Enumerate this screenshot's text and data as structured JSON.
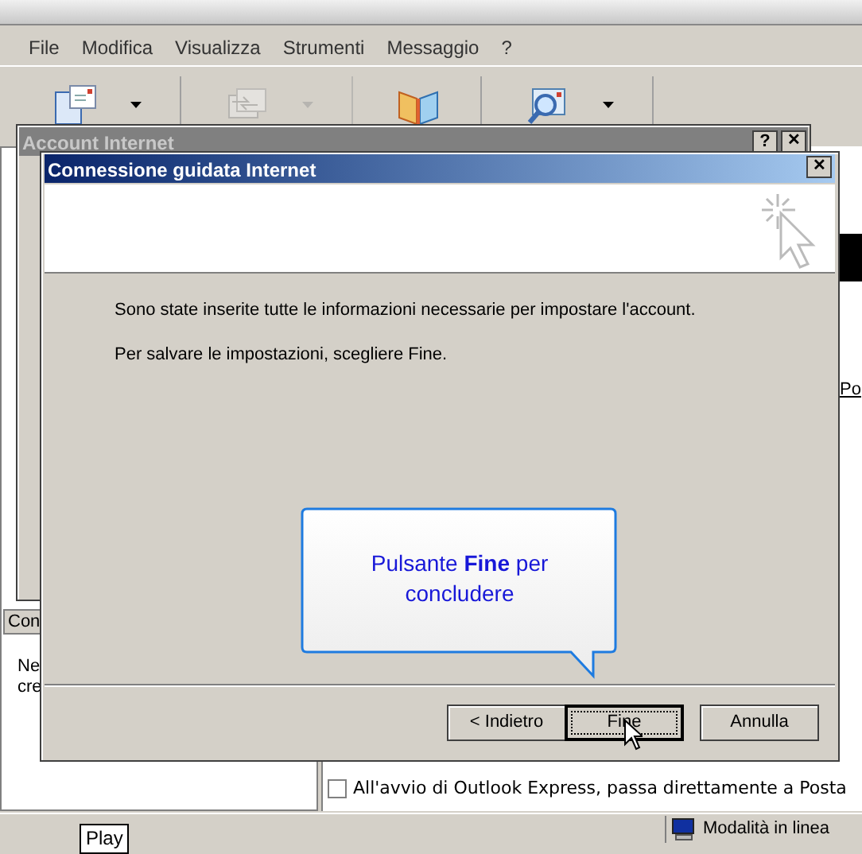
{
  "menu": [
    {
      "label": "File"
    },
    {
      "label": "Modifica"
    },
    {
      "label": "Visualizza"
    },
    {
      "label": "Strumenti"
    },
    {
      "label": "Messaggio"
    },
    {
      "label": "?"
    }
  ],
  "toolbar": [
    {
      "kind": "compose",
      "disabled": false,
      "dropdown": true
    },
    {
      "kind": "send_receive",
      "disabled": true,
      "dropdown": true
    },
    {
      "kind": "addresses",
      "disabled": false,
      "dropdown": false
    },
    {
      "kind": "find",
      "disabled": false,
      "dropdown": true
    }
  ],
  "left_pane": {
    "tab": "Con",
    "lines": [
      "Ne",
      "cre"
    ]
  },
  "right_pane": {
    "link": "Po",
    "startup_checkbox": {
      "label": "All'avvio di Outlook Express, passa direttamente a Posta",
      "checked": false
    }
  },
  "status_bar": {
    "mode": "Modalità in linea"
  },
  "tooltip": "Play",
  "account_dialog": {
    "title": "Account Internet",
    "help": "?",
    "close": "✕",
    "active": false
  },
  "wizard": {
    "title": "Connessione guidata Internet",
    "close": "✕",
    "active": true,
    "paragraphs": [
      "Sono state inserite tutte le informazioni necessarie per impostare l'account.",
      "Per salvare le impostazioni, scegliere Fine."
    ],
    "callout": "Pulsante **Fine** per concludere",
    "buttons": [
      {
        "label": "< Indietro",
        "focused": false
      },
      {
        "label": "Fine",
        "focused": true
      },
      {
        "label": "Annulla",
        "focused": false
      }
    ]
  }
}
